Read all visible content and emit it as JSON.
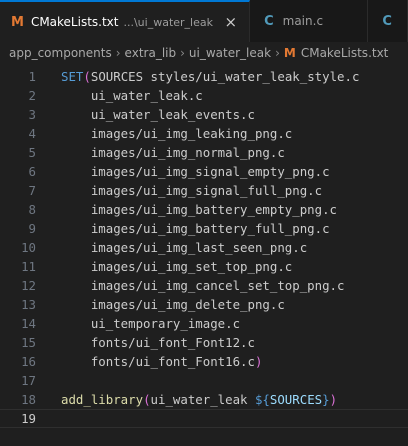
{
  "tabs": [
    {
      "icon": "M",
      "name": "CMakeLists.txt",
      "description": "...\\ui_water_leak",
      "active": true,
      "close": "×"
    },
    {
      "icon": "C",
      "name": "main.c",
      "active": false
    },
    {
      "icon": "C",
      "name": "",
      "active": false
    }
  ],
  "breadcrumb": {
    "items": [
      "app_components",
      "extra_lib",
      "ui_water_leak"
    ],
    "file_icon": "M",
    "file": "CMakeLists.txt",
    "separator": "›"
  },
  "editor": {
    "current_line": 19,
    "lines": [
      {
        "n": "1",
        "indent": "",
        "tokens": [
          {
            "t": "SET",
            "c": "kw"
          },
          {
            "t": "(",
            "c": "paren"
          },
          {
            "t": "SOURCES styles/ui_water_leak_style.c",
            "c": "txt"
          }
        ]
      },
      {
        "n": "2",
        "indent": "    ",
        "tokens": [
          {
            "t": "ui_water_leak.c",
            "c": "txt"
          }
        ]
      },
      {
        "n": "3",
        "indent": "    ",
        "tokens": [
          {
            "t": "ui_water_leak_events.c",
            "c": "txt"
          }
        ]
      },
      {
        "n": "4",
        "indent": "    ",
        "tokens": [
          {
            "t": "images/ui_img_leaking_png.c",
            "c": "txt"
          }
        ]
      },
      {
        "n": "5",
        "indent": "    ",
        "tokens": [
          {
            "t": "images/ui_img_normal_png.c",
            "c": "txt"
          }
        ]
      },
      {
        "n": "6",
        "indent": "    ",
        "tokens": [
          {
            "t": "images/ui_img_signal_empty_png.c",
            "c": "txt"
          }
        ]
      },
      {
        "n": "7",
        "indent": "    ",
        "tokens": [
          {
            "t": "images/ui_img_signal_full_png.c",
            "c": "txt"
          }
        ]
      },
      {
        "n": "8",
        "indent": "    ",
        "tokens": [
          {
            "t": "images/ui_img_battery_empty_png.c",
            "c": "txt"
          }
        ]
      },
      {
        "n": "9",
        "indent": "    ",
        "tokens": [
          {
            "t": "images/ui_img_battery_full_png.c",
            "c": "txt"
          }
        ]
      },
      {
        "n": "10",
        "indent": "    ",
        "tokens": [
          {
            "t": "images/ui_img_last_seen_png.c",
            "c": "txt"
          }
        ]
      },
      {
        "n": "11",
        "indent": "    ",
        "tokens": [
          {
            "t": "images/ui_img_set_top_png.c",
            "c": "txt"
          }
        ]
      },
      {
        "n": "12",
        "indent": "    ",
        "tokens": [
          {
            "t": "images/ui_img_cancel_set_top_png.c",
            "c": "txt"
          }
        ]
      },
      {
        "n": "13",
        "indent": "    ",
        "tokens": [
          {
            "t": "images/ui_img_delete_png.c",
            "c": "txt"
          }
        ]
      },
      {
        "n": "14",
        "indent": "    ",
        "tokens": [
          {
            "t": "ui_temporary_image.c",
            "c": "txt"
          }
        ]
      },
      {
        "n": "15",
        "indent": "    ",
        "tokens": [
          {
            "t": "fonts/ui_font_Font12.c",
            "c": "txt"
          }
        ]
      },
      {
        "n": "16",
        "indent": "    ",
        "tokens": [
          {
            "t": "fonts/ui_font_Font16.c",
            "c": "txt"
          },
          {
            "t": ")",
            "c": "paren"
          }
        ]
      },
      {
        "n": "17",
        "indent": "",
        "tokens": []
      },
      {
        "n": "18",
        "indent": "",
        "tokens": [
          {
            "t": "add_library",
            "c": "fn"
          },
          {
            "t": "(",
            "c": "paren"
          },
          {
            "t": "ui_water_leak ",
            "c": "txt"
          },
          {
            "t": "${",
            "c": "kw"
          },
          {
            "t": "SOURCES",
            "c": "var"
          },
          {
            "t": "}",
            "c": "kw"
          },
          {
            "t": ")",
            "c": "paren"
          }
        ]
      },
      {
        "n": "19",
        "indent": "",
        "tokens": []
      }
    ]
  },
  "colors": {
    "accent": "#0078d4",
    "cmake_icon": "#e37933",
    "c_icon": "#519aba"
  }
}
